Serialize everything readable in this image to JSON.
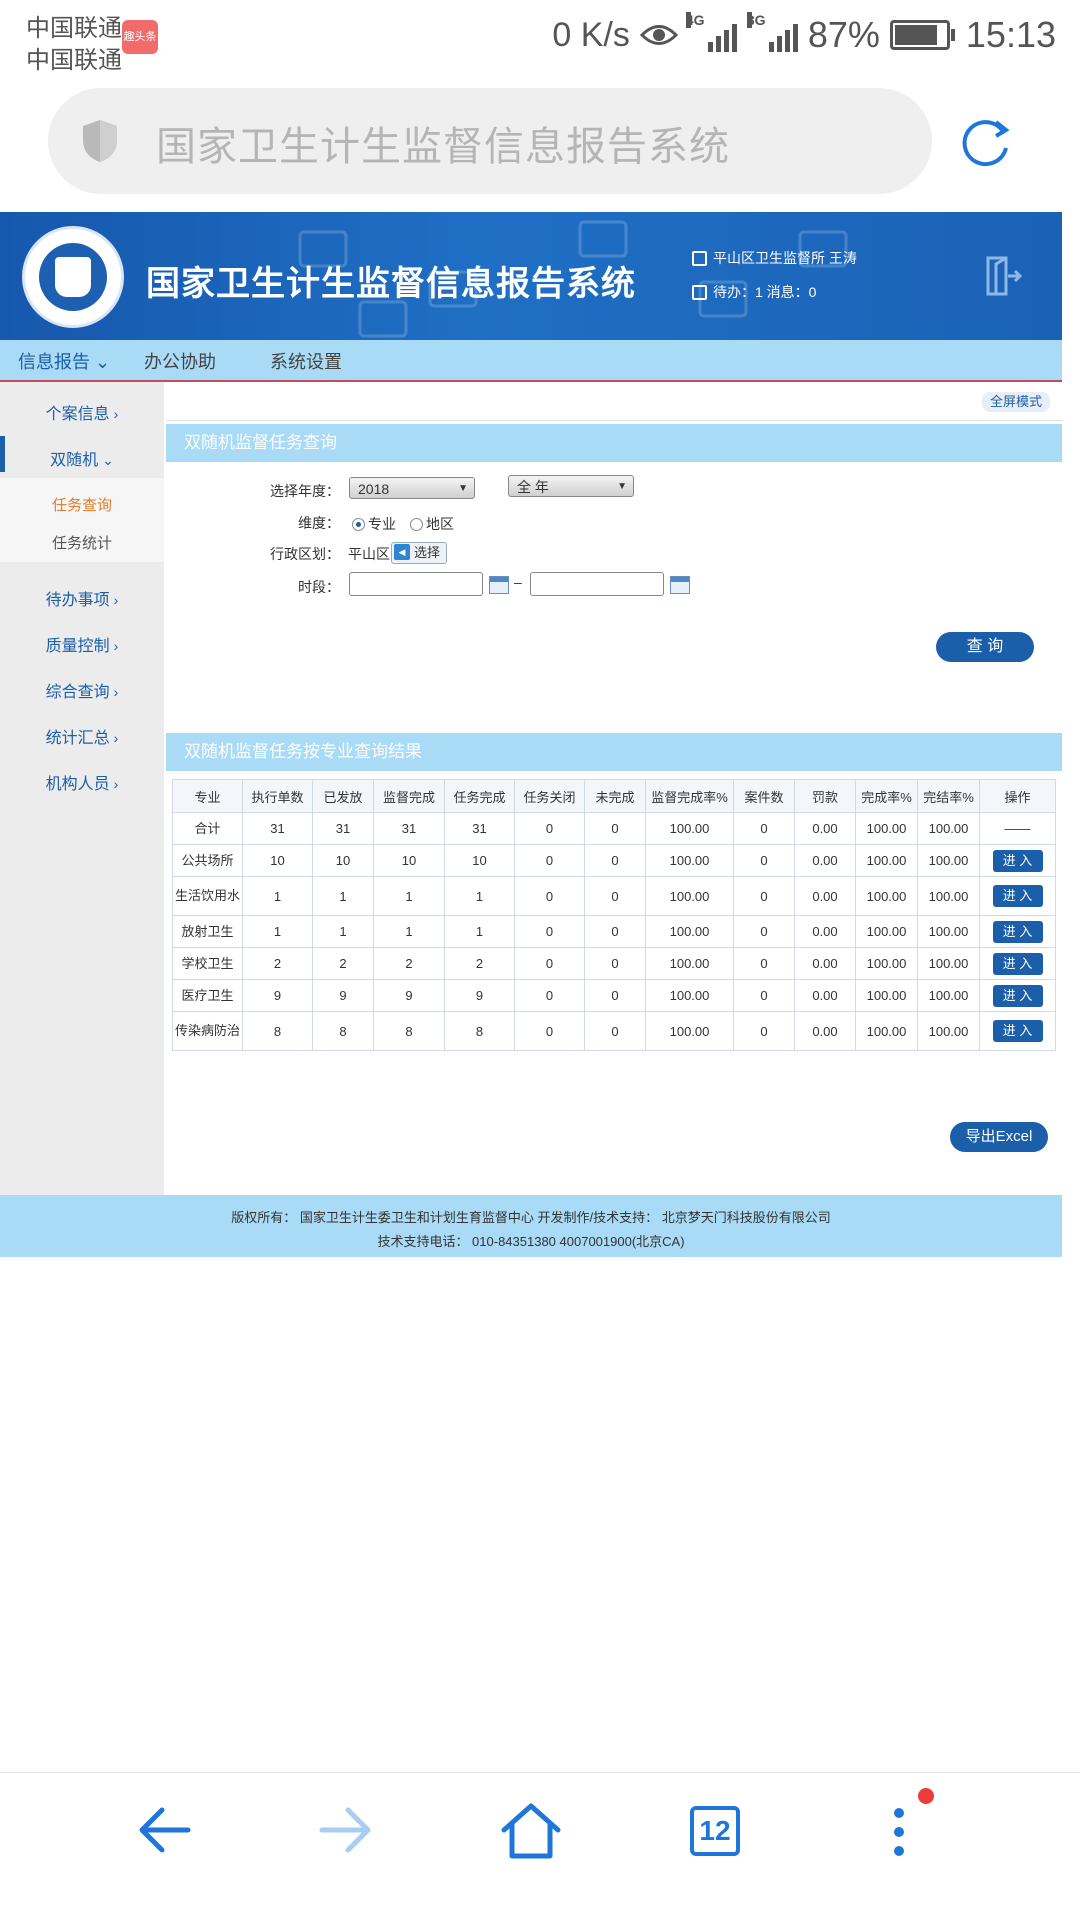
{
  "status_bar": {
    "carrier1": "中国联通",
    "carrier2": "中国联通",
    "badge": "趣头条",
    "speed": "0 K/s",
    "net1": "4G",
    "net2": "3G",
    "battery": "87%",
    "battery_level": 0.87,
    "time": "15:13"
  },
  "browser": {
    "url_title": "国家卫生计生监督信息报告系统",
    "tab_count": "12",
    "icons": [
      "shield-icon",
      "reload-icon",
      "back-icon",
      "forward-icon",
      "home-icon",
      "tabs-icon",
      "more-icon"
    ]
  },
  "header": {
    "title": "国家卫生计生监督信息报告系统",
    "user": "平山区卫生监督所 王涛",
    "todo": "待办：1  消息：0"
  },
  "nav": {
    "items": [
      {
        "label": "信息报告 ⌄"
      },
      {
        "label": "办公协助"
      },
      {
        "label": "系统设置"
      }
    ]
  },
  "sidebar": {
    "items": [
      {
        "label": "个案信息"
      },
      {
        "label": "双随机"
      },
      {
        "label": "待办事项"
      },
      {
        "label": "质量控制"
      },
      {
        "label": "综合查询"
      },
      {
        "label": "统计汇总"
      },
      {
        "label": "机构人员"
      }
    ],
    "sub_items": [
      {
        "label": "任务查询"
      },
      {
        "label": "任务统计"
      }
    ]
  },
  "content": {
    "fullscreen": "全屏模式",
    "query_panel_title": "双随机监督任务查询",
    "result_panel_title": "双随机监督任务按专业查询结果",
    "form": {
      "year_label": "选择年度：",
      "year_value": "2018",
      "period_value": "全 年",
      "dimension_label": "维度：",
      "dim_option1": "专业",
      "dim_option2": "地区",
      "region_label": "行政区划：",
      "region_value": "平山区",
      "pick_button": "选择",
      "time_label": "时段：",
      "dash": "–",
      "query_button": "查 询"
    },
    "export_button": "导出Excel"
  },
  "table": {
    "headers": [
      "专业",
      "执行单数",
      "已发放",
      "监督完成",
      "任务完成",
      "任务关闭",
      "未完成",
      "监督完成率%",
      "案件数",
      "罚款",
      "完成率%",
      "完结率%",
      "操作"
    ],
    "enter_label": "进 入",
    "rows": [
      {
        "name": "合计",
        "c": [
          "31",
          "31",
          "31",
          "31",
          "0",
          "0",
          "100.00",
          "0",
          "0.00",
          "100.00",
          "100.00"
        ],
        "op": "——"
      },
      {
        "name": "公共场所",
        "c": [
          "10",
          "10",
          "10",
          "10",
          "0",
          "0",
          "100.00",
          "0",
          "0.00",
          "100.00",
          "100.00"
        ]
      },
      {
        "name": "生活饮用水",
        "c": [
          "1",
          "1",
          "1",
          "1",
          "0",
          "0",
          "100.00",
          "0",
          "0.00",
          "100.00",
          "100.00"
        ]
      },
      {
        "name": "放射卫生",
        "c": [
          "1",
          "1",
          "1",
          "1",
          "0",
          "0",
          "100.00",
          "0",
          "0.00",
          "100.00",
          "100.00"
        ]
      },
      {
        "name": "学校卫生",
        "c": [
          "2",
          "2",
          "2",
          "2",
          "0",
          "0",
          "100.00",
          "0",
          "0.00",
          "100.00",
          "100.00"
        ]
      },
      {
        "name": "医疗卫生",
        "c": [
          "9",
          "9",
          "9",
          "9",
          "0",
          "0",
          "100.00",
          "0",
          "0.00",
          "100.00",
          "100.00"
        ]
      },
      {
        "name": "传染病防治",
        "c": [
          "8",
          "8",
          "8",
          "8",
          "0",
          "0",
          "100.00",
          "0",
          "0.00",
          "100.00",
          "100.00"
        ]
      }
    ]
  },
  "footer": {
    "line1": "版权所有：  国家卫生计生委卫生和计划生育监督中心      开发制作/技术支持：  北京梦天门科技股份有限公司",
    "line2": "技术支持电话：  010-84351380 4007001900(北京CA)"
  },
  "colors": {
    "primary": "#1b5ea9",
    "header_blue": "#1f6fc4",
    "panel_light_blue": "#a9daf6",
    "active_orange": "#e97b2a",
    "browser_blue": "#1e76d9"
  }
}
